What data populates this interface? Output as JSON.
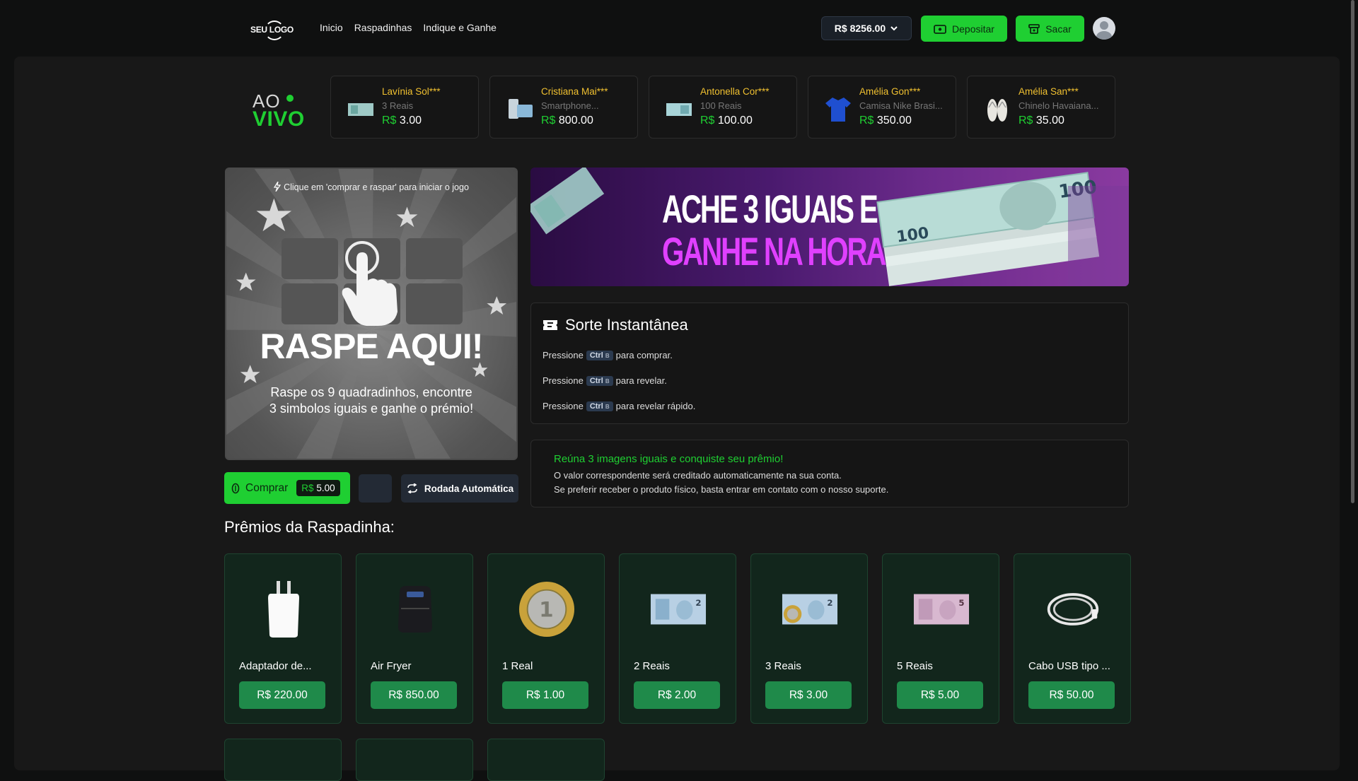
{
  "header": {
    "logo_text": "SEU LOGO",
    "nav": [
      "Inicio",
      "Raspadinhas",
      "Indique e Ganhe"
    ],
    "balance": "R$ 8256.00",
    "deposit_label": "Depositar",
    "withdraw_label": "Sacar"
  },
  "live": {
    "ao": "AO",
    "vivo": "VIVO",
    "winners": [
      {
        "name": "Lavínia Sol***",
        "item": "3 Reais",
        "currency": "R$",
        "amount": "3.00",
        "icon": "banknote-icon"
      },
      {
        "name": "Cristiana Mai***",
        "item": "Smartphone...",
        "currency": "R$",
        "amount": "800.00",
        "icon": "smartphone-icon"
      },
      {
        "name": "Antonella Cor***",
        "item": "100 Reais",
        "currency": "R$",
        "amount": "100.00",
        "icon": "banknote-icon"
      },
      {
        "name": "Amélia Gon***",
        "item": "Camisa Nike Brasi...",
        "currency": "R$",
        "amount": "350.00",
        "icon": "shirt-icon"
      },
      {
        "name": "Amélia San***",
        "item": "Chinelo Havaiana...",
        "currency": "R$",
        "amount": "35.00",
        "icon": "sandals-icon"
      }
    ]
  },
  "scratch": {
    "hint": "Clique em 'comprar e raspar' para iniciar o jogo",
    "title": "RASPE AQUI!",
    "subtitle_line1": "Raspe os 9 quadradinhos, encontre",
    "subtitle_line2": "3 simbolos iguais e ganhe o prémio!"
  },
  "buy": {
    "label": "Comprar",
    "currency": "R$",
    "price": "5.00",
    "auto_label": "Rodada Automática"
  },
  "banner": {
    "line1": "ACHE 3 IGUAIS E",
    "line2": "GANHE NA HORA"
  },
  "sorte": {
    "title": "Sorte Instantânea",
    "rows": [
      {
        "prefix": "Pressione",
        "key": "Ctrl",
        "key_sub": "B",
        "suffix": "para comprar."
      },
      {
        "prefix": "Pressione",
        "key": "Ctrl",
        "key_sub": "B",
        "suffix": "para revelar."
      },
      {
        "prefix": "Pressione",
        "key": "Ctrl",
        "key_sub": "B",
        "suffix": "para revelar rápido."
      }
    ]
  },
  "info": {
    "headline": "Reúna 3 imagens iguais e conquiste seu prêmio!",
    "line1": "O valor correspondente será creditado automaticamente na sua conta.",
    "line2": "Se preferir receber o produto físico, basta entrar em contato com o nosso suporte."
  },
  "prizes": {
    "title": "Prêmios da Raspadinha:",
    "items": [
      {
        "name": "Adaptador de...",
        "price": "R$ 220.00",
        "icon": "charger-icon"
      },
      {
        "name": "Air Fryer",
        "price": "R$ 850.00",
        "icon": "air-fryer-icon"
      },
      {
        "name": "1 Real",
        "price": "R$ 1.00",
        "icon": "coin-icon"
      },
      {
        "name": "2 Reais",
        "price": "R$ 2.00",
        "icon": "banknote-icon"
      },
      {
        "name": "3 Reais",
        "price": "R$ 3.00",
        "icon": "banknote-coin-icon"
      },
      {
        "name": "5 Reais",
        "price": "R$ 5.00",
        "icon": "banknote-icon"
      },
      {
        "name": "Cabo USB tipo ...",
        "price": "R$ 50.00",
        "icon": "usb-cable-icon"
      }
    ]
  },
  "colors": {
    "accent": "#1fcf32",
    "winner_name": "#f0c030",
    "prize_card": "#12261c",
    "prize_button": "#1f8a4a"
  }
}
